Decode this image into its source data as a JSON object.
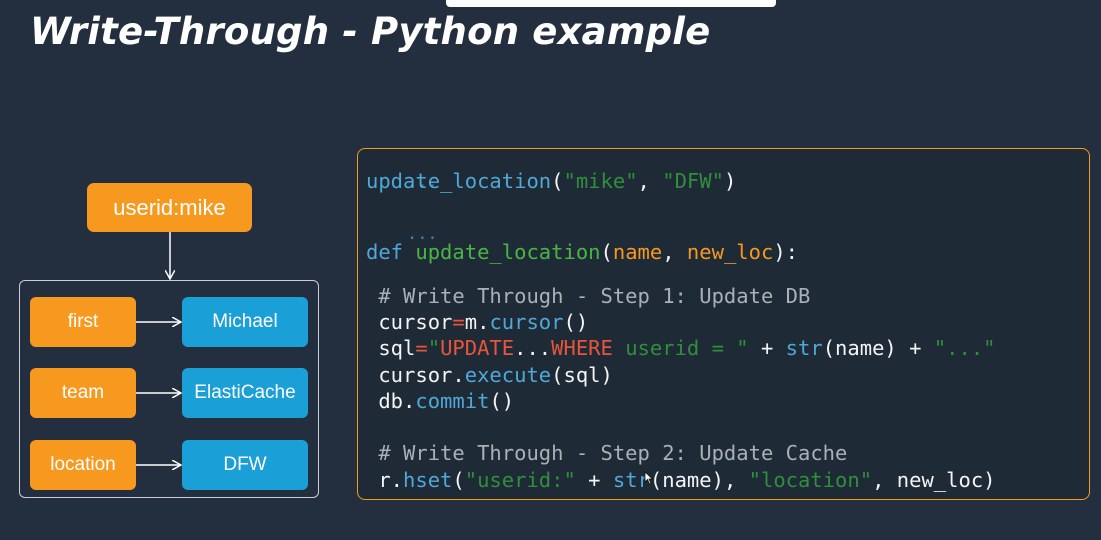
{
  "slide": {
    "title": "Write-Through - Python example"
  },
  "diagram": {
    "key": "userid:mike",
    "rows": [
      {
        "field": "first",
        "value": "Michael"
      },
      {
        "field": "team",
        "value": "ElastiCache"
      },
      {
        "field": "location",
        "value": "DFW"
      }
    ]
  },
  "code": {
    "l1": "...",
    "l2_fn": "update_location",
    "l2_p1": "(",
    "l2_a1": "\"mike\"",
    "l2_comma": ", ",
    "l2_a2": "\"DFW\"",
    "l2_p2": ")",
    "l3": "...",
    "l4_def": "def",
    "l4_fn": " update_location",
    "l4_p1": "(",
    "l4_a1": "name",
    "l4_comma": ", ",
    "l4_a2": "new_loc",
    "l4_p2": "):",
    "l5": " # Write Through - Step 1: Update DB",
    "l6_a": " cursor",
    "l6_eq": "=",
    "l6_m": "m.",
    "l6_fn": "cursor",
    "l6_p": "()",
    "l7_a": " sql",
    "l7_eq": "=",
    "l7_q1": "\"",
    "l7_kw1": "UPDATE",
    "l7_dots": "...",
    "l7_kw2": "WHERE",
    "l7_rest": " userid = \"",
    "l7_plus": " + ",
    "l7_str": "str",
    "l7_arg": "(name)",
    "l7_plus2": " + ",
    "l7_end": "\"...\"",
    "l8_a": " cursor.",
    "l8_fn": "execute",
    "l8_p": "(sql)",
    "l9_a": " db.",
    "l9_fn": "commit",
    "l9_p": "()",
    "l10": " # Write Through - Step 2: Update Cache",
    "l11_a": " r.",
    "l11_fn": "hset",
    "l11_p1": "(",
    "l11_s1": "\"userid:\"",
    "l11_plus": " + ",
    "l11_str": "str",
    "l11_arg": "(name), ",
    "l11_s2": "\"location\"",
    "l11_end": ", new_loc)"
  },
  "colors": {
    "background": "#232f3e",
    "orange": "#f7991e",
    "blue": "#1b9fd7"
  }
}
